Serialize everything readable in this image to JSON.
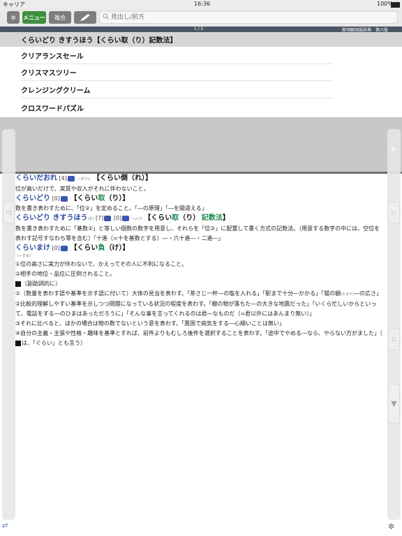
{
  "status_bar": {
    "carrier": "キャリア",
    "time": "16:36",
    "battery": "100%"
  },
  "toolbar": {
    "menu_label": "メニュー",
    "fukugo_label": "複合",
    "search_placeholder": "見出し/前方",
    "search_value": ""
  },
  "page_indicator": {
    "page": "1 / 5",
    "dictionary": "新明解国語辞典　第六版"
  },
  "list": {
    "items": [
      "くらいどり きすうほう【くらい取（り）記数法】",
      "クリアランスセール",
      "クリスマスツリー",
      "クレンジングクリーム",
      "クロスワードパズル"
    ]
  },
  "side": {
    "plus": "+",
    "left_arrow": "◁",
    "right_arrow": "▷",
    "up_arrow": "△",
    "down_arrow": "▼"
  },
  "entries": {
    "e1": {
      "reading": "くらいだおれ",
      "num": "[4]",
      "note": "―ダフレ",
      "kanji_open": "【くらい倒（れ）",
      "kanji_close": "】"
    },
    "e1_def": "位が高いだけで、実質や収入がそれに伴わないこと。",
    "e2": {
      "reading": "くらいどり",
      "num": "[0]",
      "k1": "【くらい",
      "k2": "取",
      "k3": "（り）】"
    },
    "e2_def": "数を書き表わすために、「位②」を定めること。「―の原理」「―を間違える」",
    "e3": {
      "reading": "くらいどり きすうほう",
      "tag": "(オ)",
      "num1": "[7]",
      "num2": "[0]",
      "note": "―ハフ",
      "k1": "【くらい",
      "k2": "取",
      "k3": "（り）",
      "k4": "記数法",
      "k5": "】"
    },
    "e3_def": "数を書き表わすために「基数②」と等しい個数の数字を用意し、それらを「位②」に配置して書く方式の記数法。〔用意する数字の中には、空位を表わす記号すなわち零を含む〕「十進（=十を基数とする）―・六十進―・二進―」",
    "e4": {
      "reading": "くらいまけ",
      "num": "[0]",
      "k1": "【くらい",
      "k2": "負",
      "k3": "（け）】"
    },
    "e4_sub": "（―する）",
    "e4_d1": "①位の高さに実力が伴わないで、かえってその人に不利になること。",
    "e4_d2": "②相手の地位・品位に圧倒されること。",
    "fukujoshi": "〔副助詞的に〕",
    "f1": "①〔数量を表わす語や基準を示す語に付いて〕大体の見当を表わす。「茶さじ一杯―の塩を入れる」「駅まで十分―かかる」「猫の額",
    "f1_ruby": "(ヒタイ)",
    "f1_end": "―の広さ」",
    "f2": "②比較的理解しやすい基準を示しつつ問題になっている状況の程度を表わす。「棚の物が落ちた―の大きな地震だった」「いくら忙しいからといって、電話をする―のひまはあっただろうに」「そんな事を言ってくれるのは君―なものだ〔=君以外にはあんまり無い〕」",
    "f3": "③それに比べると、ほかの場合は物の数でないという意を表わす。「異国で病気をする―心細いことは無い」",
    "f4": "④自分の主義・主張や性格・趣味を基準とすれば、前件よりもむしろ後件を選択することを表わす。「途中でやめる―なら、やらない方がました」〔",
    "f4_end": "は、「ぐらい」とも言う〕"
  }
}
